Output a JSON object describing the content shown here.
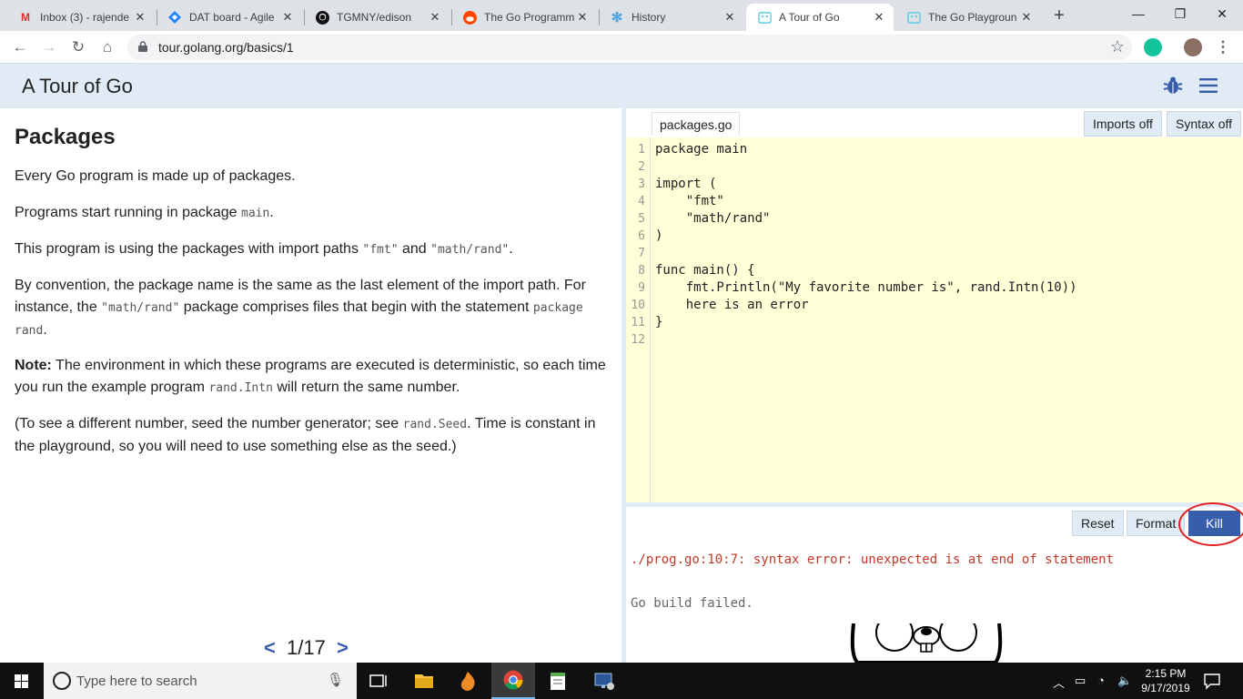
{
  "browser": {
    "tabs": [
      {
        "title": "Inbox (3) - rajende",
        "icon": "gmail-icon",
        "active": false
      },
      {
        "title": "DAT board - Agile",
        "icon": "jira-icon",
        "active": false
      },
      {
        "title": "TGMNY/edison",
        "icon": "github-icon",
        "active": false
      },
      {
        "title": "The Go Programm",
        "icon": "reddit-icon",
        "active": false
      },
      {
        "title": "History",
        "icon": "history-icon",
        "active": false
      },
      {
        "title": "A Tour of Go",
        "icon": "gopher-icon",
        "active": true
      },
      {
        "title": "The Go Playgroun",
        "icon": "gopher-icon",
        "active": false
      }
    ],
    "url": "tour.golang.org/basics/1"
  },
  "header": {
    "title": "A Tour of Go"
  },
  "lesson": {
    "heading": "Packages",
    "p1": "Every Go program is made up of packages.",
    "p2_a": "Programs start running in package ",
    "p2_code": "main",
    "p2_b": ".",
    "p3_a": "This program is using the packages with import paths ",
    "p3_code1": "\"fmt\"",
    "p3_b": " and ",
    "p3_code2": "\"math/rand\"",
    "p3_c": ".",
    "p4_a": "By convention, the package name is the same as the last element of the import path. For instance, the ",
    "p4_code1": "\"math/rand\"",
    "p4_b": " package comprises files that begin with the statement ",
    "p4_code2": "package rand",
    "p4_c": ".",
    "p5_bold": "Note:",
    "p5_a": " The environment in which these programs are executed is deterministic, so each time you run the example program ",
    "p5_code": "rand.Intn",
    "p5_b": " will return the same number.",
    "p6_a": "(To see a different number, seed the number generator; see ",
    "p6_code": "rand.Seed",
    "p6_b": ". Time is constant in the playground, so you will need to use something else as the seed.)",
    "pager": {
      "prev": "<",
      "label": "1/17",
      "next": ">"
    }
  },
  "editor": {
    "file_tab": "packages.go",
    "imports_btn": "Imports off",
    "syntax_btn": "Syntax off",
    "code_lines": [
      "package main",
      "",
      "import (",
      "    \"fmt\"",
      "    \"math/rand\"",
      ")",
      "",
      "func main() {",
      "    fmt.Println(\"My favorite number is\", rand.Intn(10))",
      "    here is an error",
      "}",
      ""
    ],
    "line_numbers": [
      "1",
      "2",
      "3",
      "4",
      "5",
      "6",
      "7",
      "8",
      "9",
      "10",
      "11",
      "12"
    ],
    "reset_btn": "Reset",
    "format_btn": "Format",
    "kill_btn": "Kill",
    "error_text": "./prog.go:10:7: syntax error: unexpected is at end of statement",
    "build_text": "Go build failed."
  },
  "taskbar": {
    "search_placeholder": "Type here to search",
    "time": "2:15 PM",
    "date": "9/17/2019"
  },
  "colors": {
    "header_bg": "#e0ebf5",
    "editor_bg": "#ffffd8",
    "kill_bg": "#375eab",
    "error_text": "#c0392b",
    "annotation_ring": "#e02020"
  }
}
